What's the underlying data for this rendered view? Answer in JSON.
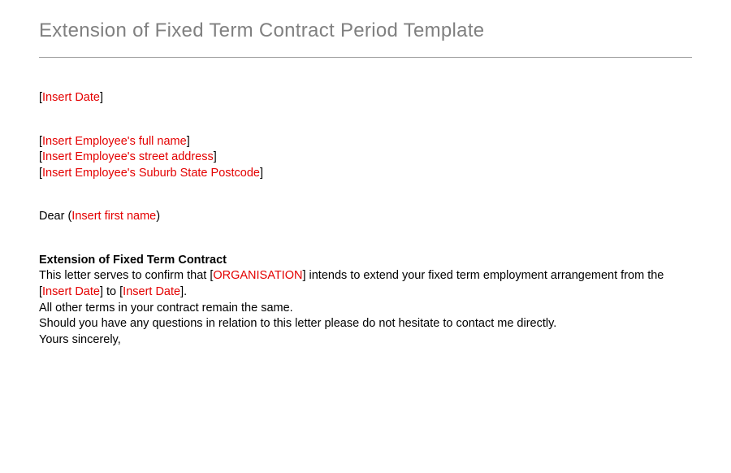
{
  "title": "Extension of Fixed Term Contract Period Template",
  "date_placeholder": "Insert Date",
  "employee": {
    "full_name": "Insert Employee's full name",
    "street_address": "Insert Employee's street address",
    "suburb_state_postcode": "Insert Employee's Suburb State Postcode"
  },
  "salutation": {
    "prefix": "Dear (",
    "name_placeholder": "Insert first name",
    "suffix": ")"
  },
  "subject": "Extension  of Fixed Term Contract",
  "body": {
    "para1": {
      "t1": "This letter serves to confirm that [",
      "org": "ORGANISATION",
      "t2": "] intends to extend your fixed term employment arrangement  from the [",
      "d1": "Insert Date",
      "t3": "] to [",
      "d2": "Insert Date",
      "t4": "]."
    },
    "para2": "All other terms in your contract remain the same.",
    "para3": "Should you have any questions in relation to this letter please do not hesitate to contact me directly.",
    "para4": "Yours sincerely,"
  }
}
